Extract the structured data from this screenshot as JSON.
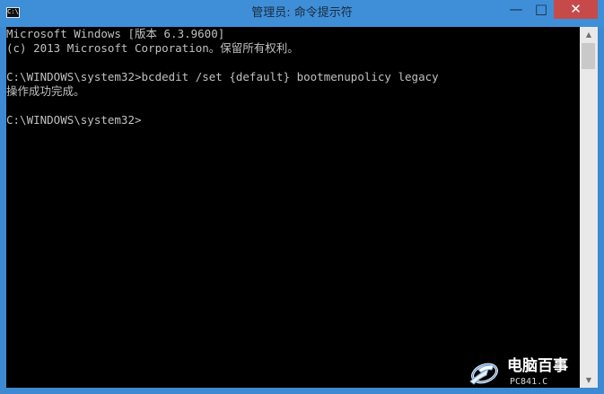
{
  "window": {
    "title": "管理员: 命令提示符",
    "icon_text": "C:\\",
    "controls": {
      "minimize": "—",
      "maximize": "□",
      "close": "✕"
    }
  },
  "console": {
    "lines": [
      "Microsoft Windows [版本 6.3.9600]",
      "(c) 2013 Microsoft Corporation。保留所有权利。",
      "",
      "C:\\WINDOWS\\system32>bcdedit /set {default} bootmenupolicy legacy",
      "操作成功完成。",
      "",
      "C:\\WINDOWS\\system32>"
    ]
  },
  "scrollbar": {
    "up_icon": "▲",
    "down_icon": "▼"
  },
  "watermark": {
    "name": "电脑百事",
    "url": "PC841.C"
  }
}
